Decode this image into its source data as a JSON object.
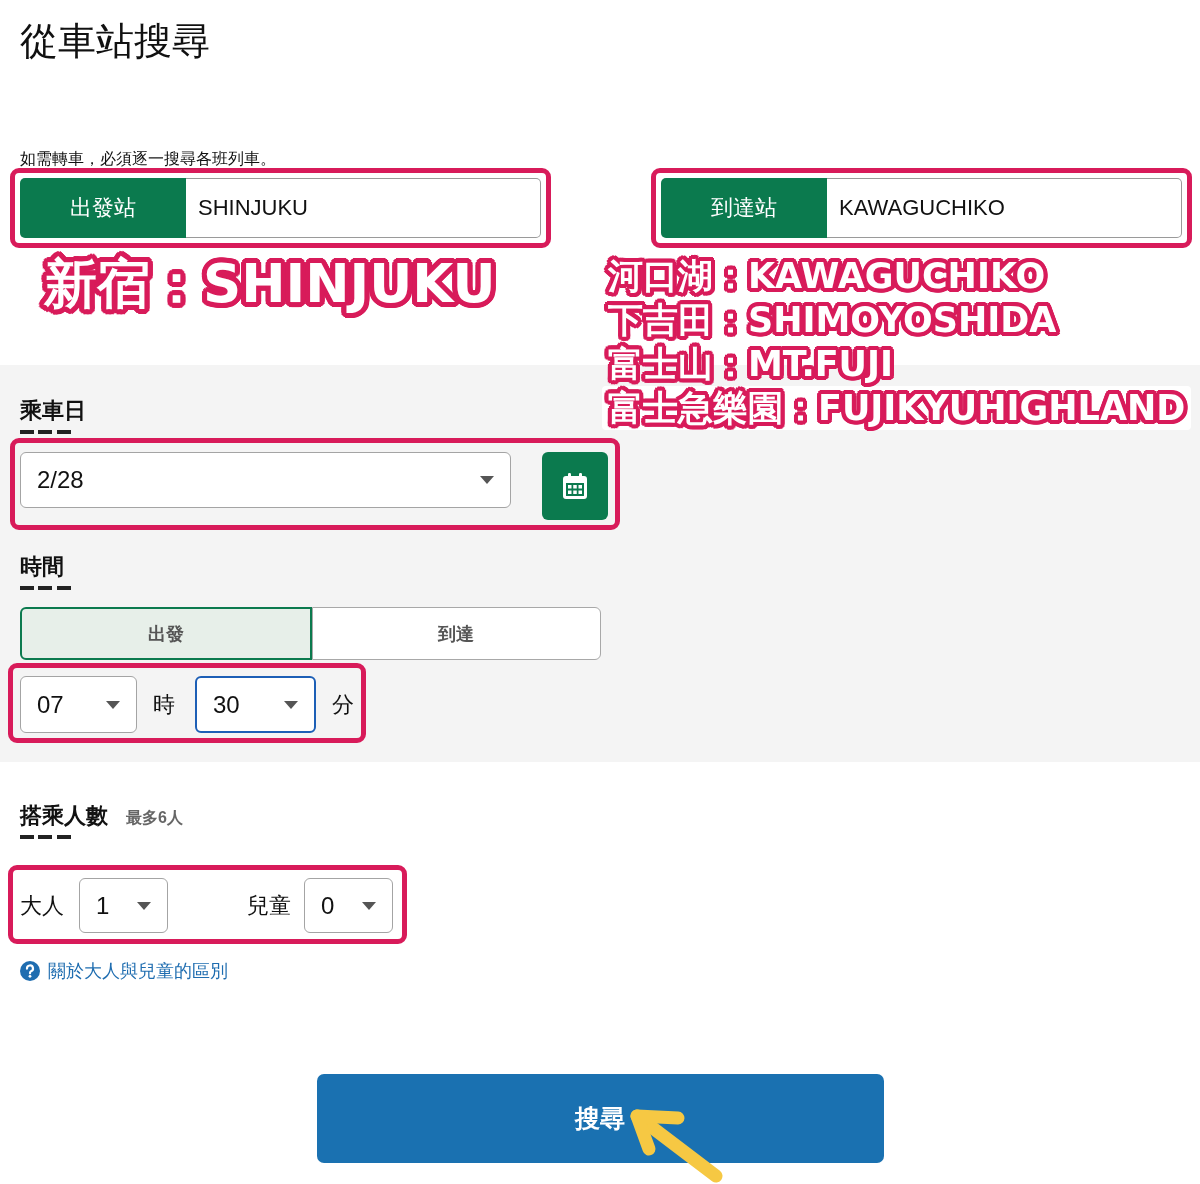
{
  "page": {
    "title": "從車站搜尋",
    "note": "如需轉車，必須逐一搜尋各班列車。"
  },
  "stations": [
    {
      "label": "出發站",
      "value": "SHINJUKU",
      "highlighted": true,
      "annotations": [
        "新宿：SHINJUKU"
      ]
    },
    {
      "label": "到達站",
      "value": "KAWAGUCHIKO",
      "highlighted": true,
      "annotations": [
        "河口湖：KAWAGUCHIKO",
        "下吉田：SHIMOYOSHIDA",
        "富士山：MT.FUJI",
        "富士急樂園：FUJIKYUHIGHLAND"
      ]
    }
  ],
  "date": {
    "label": "乘車日",
    "value": "2/28",
    "highlighted": true
  },
  "time": {
    "label": "時間",
    "modes": [
      {
        "label": "出發",
        "selected": true
      },
      {
        "label": "到達",
        "selected": false
      }
    ],
    "highlighted": true,
    "selects": [
      {
        "value": "07",
        "unit": "時",
        "focused": false
      },
      {
        "value": "30",
        "unit": "分",
        "focused": true
      }
    ]
  },
  "passengers": {
    "label": "搭乘人數",
    "hint": "最多6人",
    "highlighted": true,
    "groups": [
      {
        "label": "大人",
        "value": "1"
      },
      {
        "label": "兒童",
        "value": "0"
      }
    ],
    "help_link": "關於大人與兒童的區別"
  },
  "search_button": {
    "label": "搜尋",
    "pointer_arrow": true
  }
}
